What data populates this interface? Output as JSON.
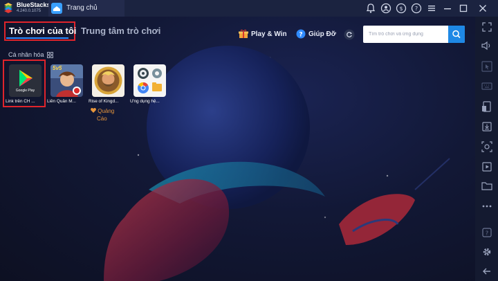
{
  "titlebar": {
    "app_name": "BlueStacks",
    "version": "4.240.0.1075",
    "tab_label": "Trang chủ",
    "icons": [
      "bell-icon",
      "user-icon",
      "coin-icon",
      "help-icon",
      "menu-icon",
      "minimize-icon",
      "maximize-icon",
      "close-icon"
    ]
  },
  "nav": {
    "my_games": "Trò chơi của tôi",
    "game_center": "Trung tâm trò chơi"
  },
  "header": {
    "play_win": "Play & Win",
    "help": "Giúp Đỡ"
  },
  "search": {
    "placeholder": "Tìm trò chơi và ứng dụng"
  },
  "section": {
    "title": "Cá nhân hóa"
  },
  "apps": [
    {
      "label": "Link trên CH ...",
      "icon": "google-play-icon",
      "inner_text": "Google Play"
    },
    {
      "label": "Liên Quân M...",
      "icon": "lien-quan-icon",
      "inner_text": "5v5"
    },
    {
      "label": "Rise of Kingd...",
      "icon": "rise-of-kingdoms-icon",
      "ad_line1": "Quảng",
      "ad_line2": "Cáo"
    },
    {
      "label": "Ứng dụng hệ...",
      "icon": "system-apps-icon"
    }
  ],
  "sidebar_icons": [
    "fullscreen-icon",
    "volume-icon",
    "cursor-icon",
    "keyboard-icon",
    "install-apk-icon",
    "screenshot-icon",
    "camera-icon",
    "video-icon",
    "folder-icon",
    "more-icon",
    "help-icon",
    "settings-icon",
    "back-icon"
  ],
  "colors": {
    "accent": "#2f8bff",
    "highlight": "#e0242b",
    "ad": "#e8963c",
    "background": "#101426"
  }
}
